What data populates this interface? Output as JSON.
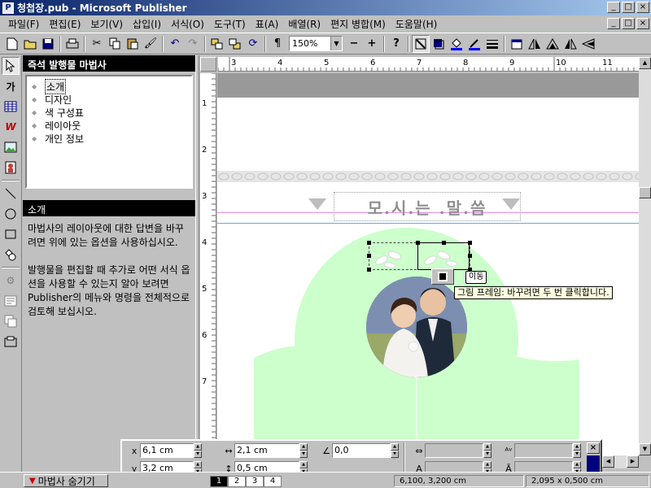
{
  "window": {
    "title": "청첩장.pub - Microsoft Publisher",
    "minimize": "_",
    "maximize": "□",
    "close": "×"
  },
  "menu": [
    "파일(F)",
    "편집(E)",
    "보기(V)",
    "삽입(I)",
    "서식(O)",
    "도구(T)",
    "표(A)",
    "배열(R)",
    "편지 병합(M)",
    "도움말(H)"
  ],
  "toolbar": {
    "zoom": "150%"
  },
  "wizard": {
    "header": "즉석 발행물 마법사",
    "items": [
      "소개",
      "디자인",
      "색 구성표",
      "레이아웃",
      "개인 정보"
    ],
    "selected_index": 0,
    "section_title": "소개",
    "description": [
      "마법사의 레이아웃에 대한 답변을 바꾸려면 위에 있는 옵션을 사용하십시오.",
      "발행물을 편집할 때 추가로 어떤 서식 옵션을 사용할 수 있는지 알아 보려면 Publisher의 메뉴와 명령을 전체적으로 검토해 보십시오."
    ]
  },
  "ruler": {
    "h_numbers": [
      "3",
      "4",
      "5",
      "6",
      "7",
      "8",
      "9",
      "10",
      "11"
    ],
    "v_numbers": [
      "1",
      "2",
      "3",
      "4",
      "5",
      "6",
      "7"
    ]
  },
  "document": {
    "heading": "모.시.는 .말.씀",
    "cursor_label": "이동",
    "tooltip": "그림 프레임: 바꾸려면 두 번 클릭합니다."
  },
  "measurements": {
    "x": "6,1 cm",
    "y": "3,2 cm",
    "width": "2,1 cm",
    "height": "0,5 cm",
    "rotation": "0,0",
    "x_label": "x",
    "y_label": "y"
  },
  "status": {
    "hide_wizard": "마법사 숨기기",
    "pages": [
      "1",
      "2",
      "3",
      "4"
    ],
    "active_page": "1",
    "position": "6,100, 3,200 cm",
    "size": "2,095 x  0,500 cm"
  }
}
